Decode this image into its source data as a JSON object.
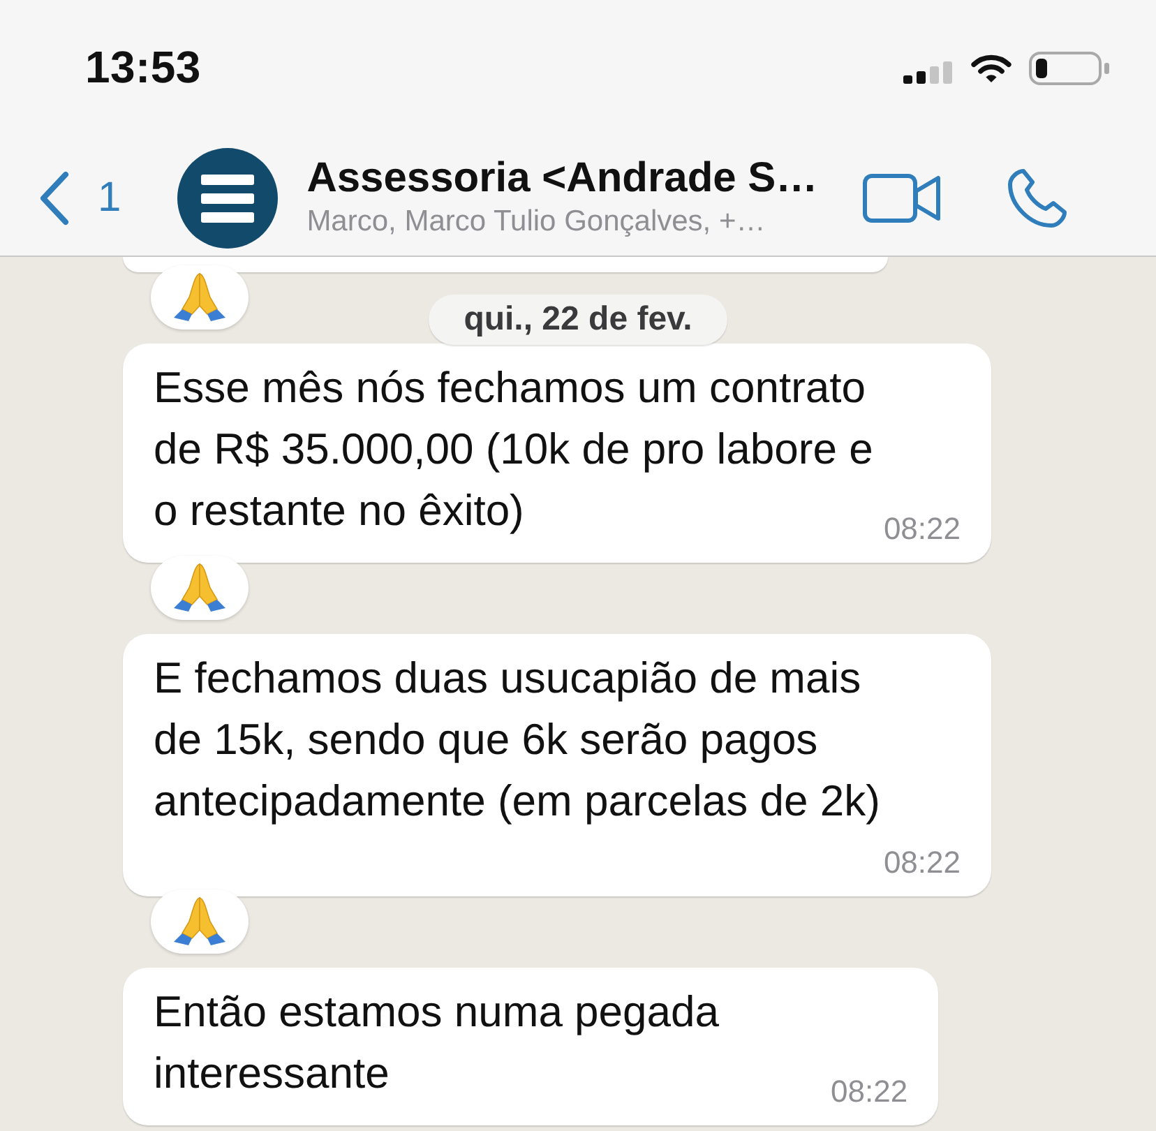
{
  "status_bar": {
    "time": "13:53"
  },
  "header": {
    "back_badge": "1",
    "title": "Assessoria <Andrade S…",
    "subtitle": "Marco, Marco Tulio Gonçalves, +…"
  },
  "chat": {
    "date_header": "qui., 22 de fev.",
    "messages": [
      {
        "kind": "cut_off",
        "reacted": true
      },
      {
        "kind": "text",
        "text": "Esse mês nós fechamos um contrato\nde R$ 35.000,00 (10k de pro labore e\no restante no êxito)",
        "time": "08:22",
        "reacted": true
      },
      {
        "kind": "text",
        "text": "E fechamos duas usucapião de mais\nde 15k, sendo que 6k serão pagos\nantecipadamente (em parcelas de 2k)",
        "time": "08:22",
        "reacted": true
      },
      {
        "kind": "text",
        "text": "Então estamos numa pegada\ninteressante",
        "time": "08:22",
        "reacted": false
      }
    ]
  }
}
